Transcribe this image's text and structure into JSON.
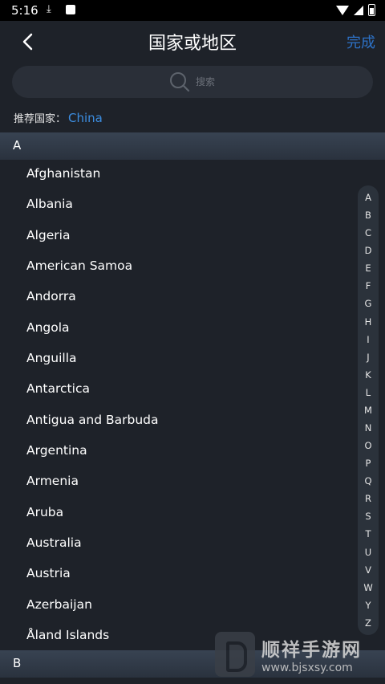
{
  "status_bar": {
    "time": "5:16",
    "download_icon": "download-icon"
  },
  "header": {
    "title": "国家或地区",
    "done": "完成"
  },
  "search": {
    "placeholder": "搜索"
  },
  "recommend": {
    "label": "推荐国家：",
    "value": "China"
  },
  "sections": {
    "a": "A",
    "b": "B"
  },
  "countries": [
    "Afghanistan",
    "Albania",
    "Algeria",
    "American Samoa",
    "Andorra",
    "Angola",
    "Anguilla",
    "Antarctica",
    "Antigua and Barbuda",
    "Argentina",
    "Armenia",
    "Aruba",
    "Australia",
    "Austria",
    "Azerbaijan",
    "Åland Islands"
  ],
  "alphabet": [
    "A",
    "B",
    "C",
    "D",
    "E",
    "F",
    "G",
    "H",
    "I",
    "J",
    "K",
    "L",
    "M",
    "N",
    "O",
    "P",
    "Q",
    "R",
    "S",
    "T",
    "U",
    "V",
    "W",
    "Y",
    "Z"
  ],
  "watermark": {
    "brand": "顺祥手游网",
    "url": "www.bjsxsy.com"
  },
  "colors": {
    "accent": "#2d72c7",
    "link": "#3c8de0",
    "background": "#1e2229"
  }
}
